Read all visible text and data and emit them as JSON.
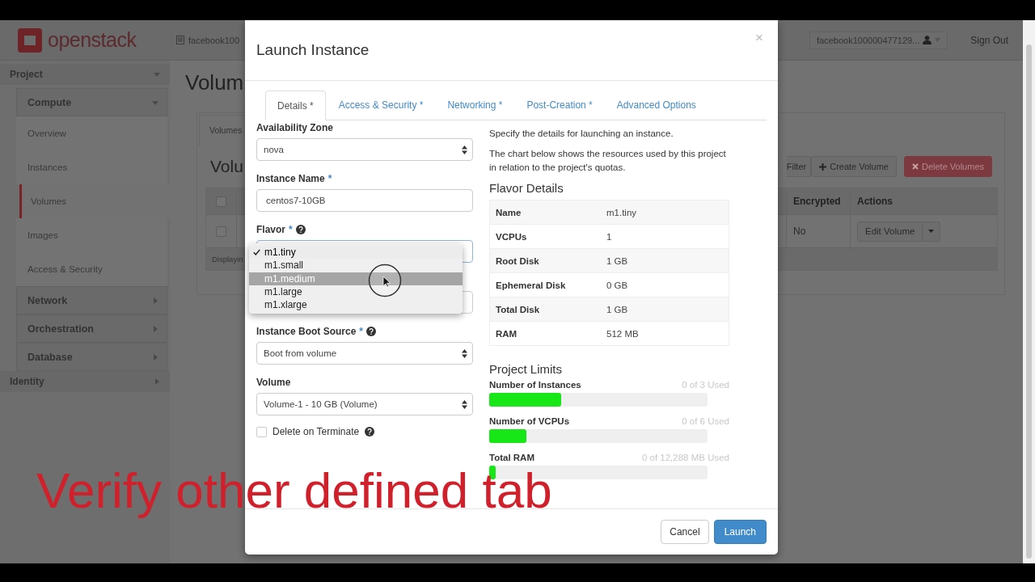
{
  "header": {
    "logo": "openstack",
    "project_selector": "facebook100",
    "user_menu": "facebook100000477129...",
    "sign_out": "Sign Out"
  },
  "sidebar": [
    {
      "label": "Project",
      "expanded": true,
      "children": [
        {
          "label": "Compute",
          "expanded": true,
          "children": [
            {
              "label": "Overview",
              "selected": false
            },
            {
              "label": "Instances",
              "selected": false
            },
            {
              "label": "Volumes",
              "selected": true
            },
            {
              "label": "Images",
              "selected": false
            },
            {
              "label": "Access & Security",
              "selected": false
            }
          ]
        },
        {
          "label": "Network",
          "expanded": false
        },
        {
          "label": "Orchestration",
          "expanded": false
        },
        {
          "label": "Database",
          "expanded": false
        }
      ]
    },
    {
      "label": "Identity",
      "expanded": false
    }
  ],
  "page": {
    "title": "Volum",
    "tab": "Volumes",
    "heading": "Volu",
    "footer": "Displayin",
    "buttons": [
      {
        "label": "Filter",
        "kind": "partial"
      },
      {
        "label": "Create Volume",
        "kind": "create"
      },
      {
        "label": "Delete Volumes",
        "kind": "danger"
      }
    ],
    "header_checked": false,
    "columns": [
      "Encrypted",
      "Actions"
    ],
    "rows": [
      {
        "checked": false,
        "encrypted": "No",
        "action": "Edit Volume"
      }
    ]
  },
  "modal": {
    "title": "Launch Instance",
    "close": "×",
    "tabs": [
      {
        "label": "Details *",
        "selected": true
      },
      {
        "label": "Access & Security *",
        "selected": false
      },
      {
        "label": "Networking *",
        "selected": false
      },
      {
        "label": "Post-Creation *",
        "selected": false
      },
      {
        "label": "Advanced Options",
        "selected": false
      }
    ],
    "fields": [
      {
        "kind": "select",
        "label": "Availability Zone",
        "value": "nova"
      },
      {
        "kind": "text",
        "label": "Instance Name",
        "required_mark": "*",
        "value": "centos7-10GB"
      },
      {
        "kind": "select",
        "label": "Flavor",
        "required_mark": "*",
        "help": true,
        "options": [
          {
            "label": "m1.tiny",
            "selected": true,
            "hovered": false
          },
          {
            "label": "m1.small",
            "selected": false,
            "hovered": false
          },
          {
            "label": "m1.medium",
            "selected": false,
            "hovered": true
          },
          {
            "label": "m1.large",
            "selected": false,
            "hovered": false
          },
          {
            "label": "m1.xlarge",
            "selected": false,
            "hovered": false
          }
        ]
      },
      {
        "kind": "text"
      },
      {
        "kind": "select",
        "label": "Instance Boot Source",
        "required_mark": "*",
        "help": true,
        "value": "Boot from volume"
      },
      {
        "kind": "select",
        "label": "Volume",
        "value": "Volume-1 - 10 GB (Volume)"
      },
      {
        "kind": "checkbox",
        "label": "Delete on Terminate",
        "help": true,
        "checked": false
      }
    ],
    "intro": [
      "Specify the details for launching an instance.",
      "The chart below shows the resources used by this project in relation to the project's quotas."
    ],
    "flavor_heading": "Flavor Details",
    "flavor_details": [
      {
        "name": "Name",
        "value": "m1.tiny"
      },
      {
        "name": "VCPUs",
        "value": "1"
      },
      {
        "name": "Root Disk",
        "value": "1 GB"
      },
      {
        "name": "Ephemeral Disk",
        "value": "0 GB"
      },
      {
        "name": "Total Disk",
        "value": "1 GB"
      },
      {
        "name": "RAM",
        "value": "512 MB"
      }
    ],
    "limits_heading": "Project Limits",
    "limits": [
      {
        "label": "Number of Instances",
        "reading": "0 of 3 Used",
        "level": 0.33
      },
      {
        "label": "Number of VCPUs",
        "reading": "0 of 6 Used",
        "level": 0.17
      },
      {
        "label": "Total RAM",
        "reading": "0 of 12,288 MB Used",
        "level": 0.03
      }
    ],
    "buttons": [
      {
        "label": "Cancel",
        "kind": "default"
      },
      {
        "label": "Launch",
        "kind": "primary"
      }
    ]
  },
  "caption": "Verify other defined tab"
}
